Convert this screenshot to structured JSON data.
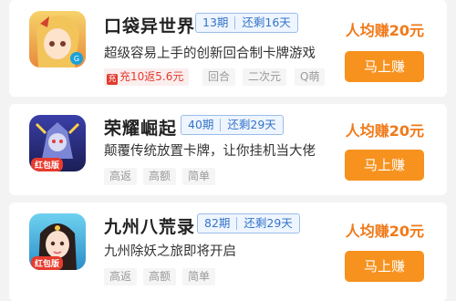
{
  "colors": {
    "accent": "#f7921e",
    "earn_text": "#f07a1a",
    "period_blue": "#3474c8"
  },
  "games": [
    {
      "title": "口袋异世界",
      "period": "13期",
      "remaining": "还剩16天",
      "description": "超级容易上手的创新回合制卡牌游戏",
      "promo": "充10返5.6元",
      "tags": [
        "回合",
        "二次元",
        "Q萌"
      ],
      "earn": "人均赚20元",
      "button": "马上赚",
      "icon_badge": ""
    },
    {
      "title": "荣耀崛起",
      "period": "40期",
      "remaining": "还剩29天",
      "description": "颠覆传统放置卡牌，让你挂机当大佬",
      "promo": "",
      "tags": [
        "高返",
        "高额",
        "简单"
      ],
      "earn": "人均赚20元",
      "button": "马上赚",
      "icon_badge": "红包版"
    },
    {
      "title": "九州八荒录",
      "period": "82期",
      "remaining": "还剩29天",
      "description": "九州除妖之旅即将开启",
      "promo": "",
      "tags": [
        "高返",
        "高额",
        "简单"
      ],
      "earn": "人均赚20元",
      "button": "马上赚",
      "icon_badge": "红包版"
    }
  ]
}
